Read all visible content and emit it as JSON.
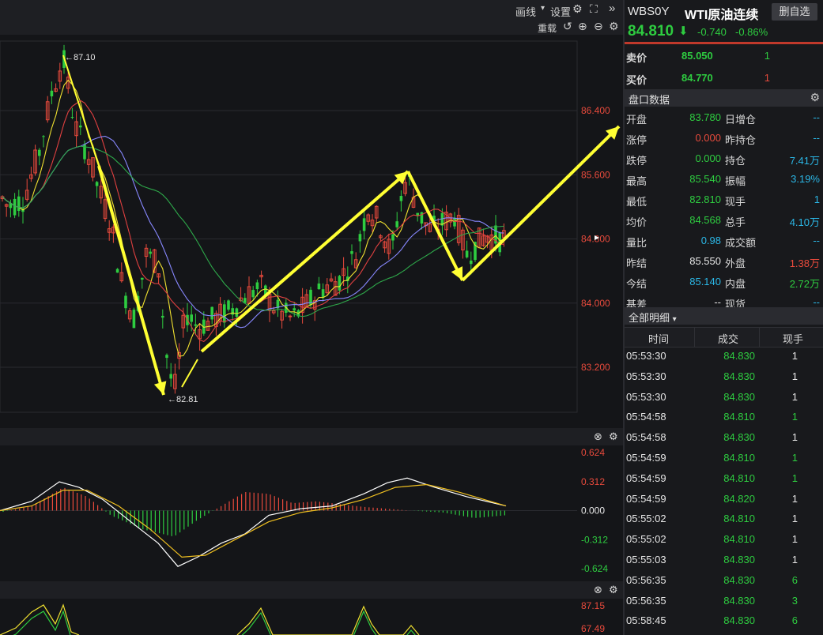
{
  "toolbar": {
    "draw_label": "画线",
    "settings_label": "设置",
    "reload_label": "重载",
    "collapse_icon": "»"
  },
  "price_axis": [
    "86.400",
    "85.600",
    "84.800",
    "84.000",
    "83.200"
  ],
  "annotations": {
    "high": "87.10",
    "low": "82.81"
  },
  "macd_axis": [
    "0.624",
    "0.312",
    "0.000",
    "-0.312",
    "-0.624"
  ],
  "kdj_axis": [
    "87.15",
    "67.49"
  ],
  "quote": {
    "code": "WBS0Y",
    "name": "WTI原油连续",
    "remove_fav": "删自选",
    "price": "84.810",
    "change": "-0.740",
    "change_pct": "-0.86%"
  },
  "order_book": {
    "sell_label": "卖价",
    "sell_price": "85.050",
    "sell_qty": "1",
    "buy_label": "买价",
    "buy_price": "84.770",
    "buy_qty": "1"
  },
  "market_data": {
    "title": "盘口数据",
    "rows": [
      {
        "l1": "开盘",
        "v1": "83.780",
        "l2": "日增仓",
        "v2": "--"
      },
      {
        "l1": "涨停",
        "v1": "0.000",
        "l2": "昨持仓",
        "v2": "--"
      },
      {
        "l1": "跌停",
        "v1": "0.000",
        "l2": "持仓",
        "v2": "7.41万"
      },
      {
        "l1": "最高",
        "v1": "85.540",
        "l2": "振幅",
        "v2": "3.19%"
      },
      {
        "l1": "最低",
        "v1": "82.810",
        "l2": "现手",
        "v2": "1"
      },
      {
        "l1": "均价",
        "v1": "84.568",
        "l2": "总手",
        "v2": "4.10万"
      },
      {
        "l1": "量比",
        "v1": "0.98",
        "l2": "成交额",
        "v2": "--"
      },
      {
        "l1": "昨结",
        "v1": "85.550",
        "l2": "外盘",
        "v2": "1.38万"
      },
      {
        "l1": "今结",
        "v1": "85.140",
        "l2": "内盘",
        "v2": "2.72万"
      },
      {
        "l1": "基差",
        "v1": "--",
        "l2": "现货",
        "v2": "--"
      }
    ]
  },
  "trades": {
    "title": "全部明细",
    "headers": [
      "时间",
      "成交",
      "现手"
    ],
    "rows": [
      {
        "time": "05:53:30",
        "price": "84.830",
        "qty": "1",
        "side": "buy"
      },
      {
        "time": "05:53:30",
        "price": "84.830",
        "qty": "1",
        "side": "buy"
      },
      {
        "time": "05:53:30",
        "price": "84.830",
        "qty": "1",
        "side": "buy"
      },
      {
        "time": "05:54:58",
        "price": "84.810",
        "qty": "1",
        "side": "sell"
      },
      {
        "time": "05:54:58",
        "price": "84.830",
        "qty": "1",
        "side": "buy"
      },
      {
        "time": "05:54:59",
        "price": "84.810",
        "qty": "1",
        "side": "sell"
      },
      {
        "time": "05:54:59",
        "price": "84.810",
        "qty": "1",
        "side": "sell"
      },
      {
        "time": "05:54:59",
        "price": "84.820",
        "qty": "1",
        "side": "buy"
      },
      {
        "time": "05:55:02",
        "price": "84.810",
        "qty": "1",
        "side": "buy"
      },
      {
        "time": "05:55:02",
        "price": "84.810",
        "qty": "1",
        "side": "buy"
      },
      {
        "time": "05:55:03",
        "price": "84.830",
        "qty": "1",
        "side": "buy"
      },
      {
        "time": "05:56:35",
        "price": "84.830",
        "qty": "6",
        "side": "sell"
      },
      {
        "time": "05:56:35",
        "price": "84.830",
        "qty": "3",
        "side": "sell"
      },
      {
        "time": "05:58:45",
        "price": "84.830",
        "qty": "6",
        "side": "sell"
      }
    ]
  },
  "colors": {
    "up": "#e84a3c",
    "down": "#2ecc40",
    "ma5": "#f0e130",
    "ma10": "#e04040",
    "ma20": "#8888ff",
    "ma60": "#2ea84a",
    "annotation": "#ffff33",
    "macd_dif": "#ffffff",
    "macd_dea": "#f0c020"
  }
}
